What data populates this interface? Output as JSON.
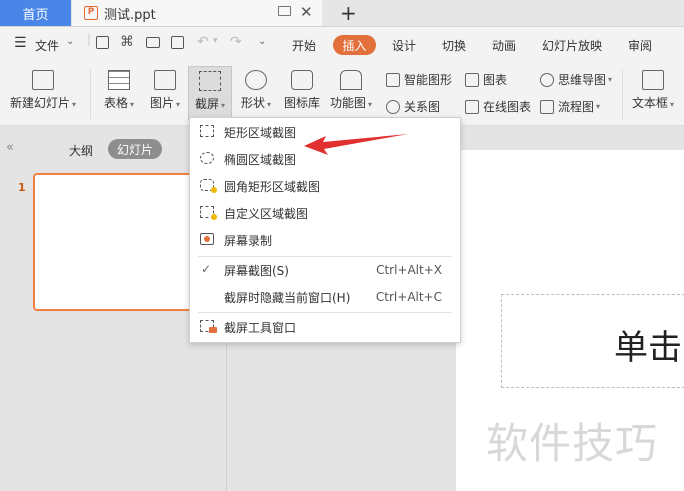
{
  "tabs": {
    "home": "首页",
    "document": "测试.ppt",
    "new_tab": "+"
  },
  "menu": {
    "file": "文件",
    "items": [
      "开始",
      "插入",
      "设计",
      "切换",
      "动画",
      "幻灯片放映",
      "审阅"
    ]
  },
  "ribbon": {
    "new_slide": "新建幻灯片",
    "table": "表格",
    "picture": "图片",
    "screenshot": "截屏",
    "shape": "形状",
    "icon_lib": "图标库",
    "function_chart": "功能图",
    "smart_art": "智能图形",
    "chart": "图表",
    "mind_map": "思维导图",
    "relation": "关系图",
    "online_chart": "在线图表",
    "flowchart": "流程图",
    "textbox": "文本框"
  },
  "left_pane": {
    "outline": "大纲",
    "slides": "幻灯片",
    "slide_number": "1"
  },
  "slide": {
    "title_text": "单击",
    "watermark": "软件技巧"
  },
  "dropdown": {
    "items": [
      {
        "label": "矩形区域截图",
        "icon": "rect-select-icon"
      },
      {
        "label": "椭圆区域截图",
        "icon": "ellipse-select-icon"
      },
      {
        "label": "圆角矩形区域截图",
        "icon": "rounded-rect-select-icon"
      },
      {
        "label": "自定义区域截图",
        "icon": "custom-select-icon"
      },
      {
        "label": "屏幕录制",
        "icon": "screen-record-icon"
      },
      {
        "label": "屏幕截图(S)",
        "shortcut": "Ctrl+Alt+X",
        "checked": true
      },
      {
        "label": "截屏时隐藏当前窗口(H)",
        "shortcut": "Ctrl+Alt+C"
      },
      {
        "label": "截屏工具窗口",
        "icon": "screenshot-tool-icon"
      }
    ]
  },
  "colors": {
    "accent_blue": "#4a86e8",
    "insert_orange": "#e2703a",
    "arrow_red": "#e03030"
  }
}
